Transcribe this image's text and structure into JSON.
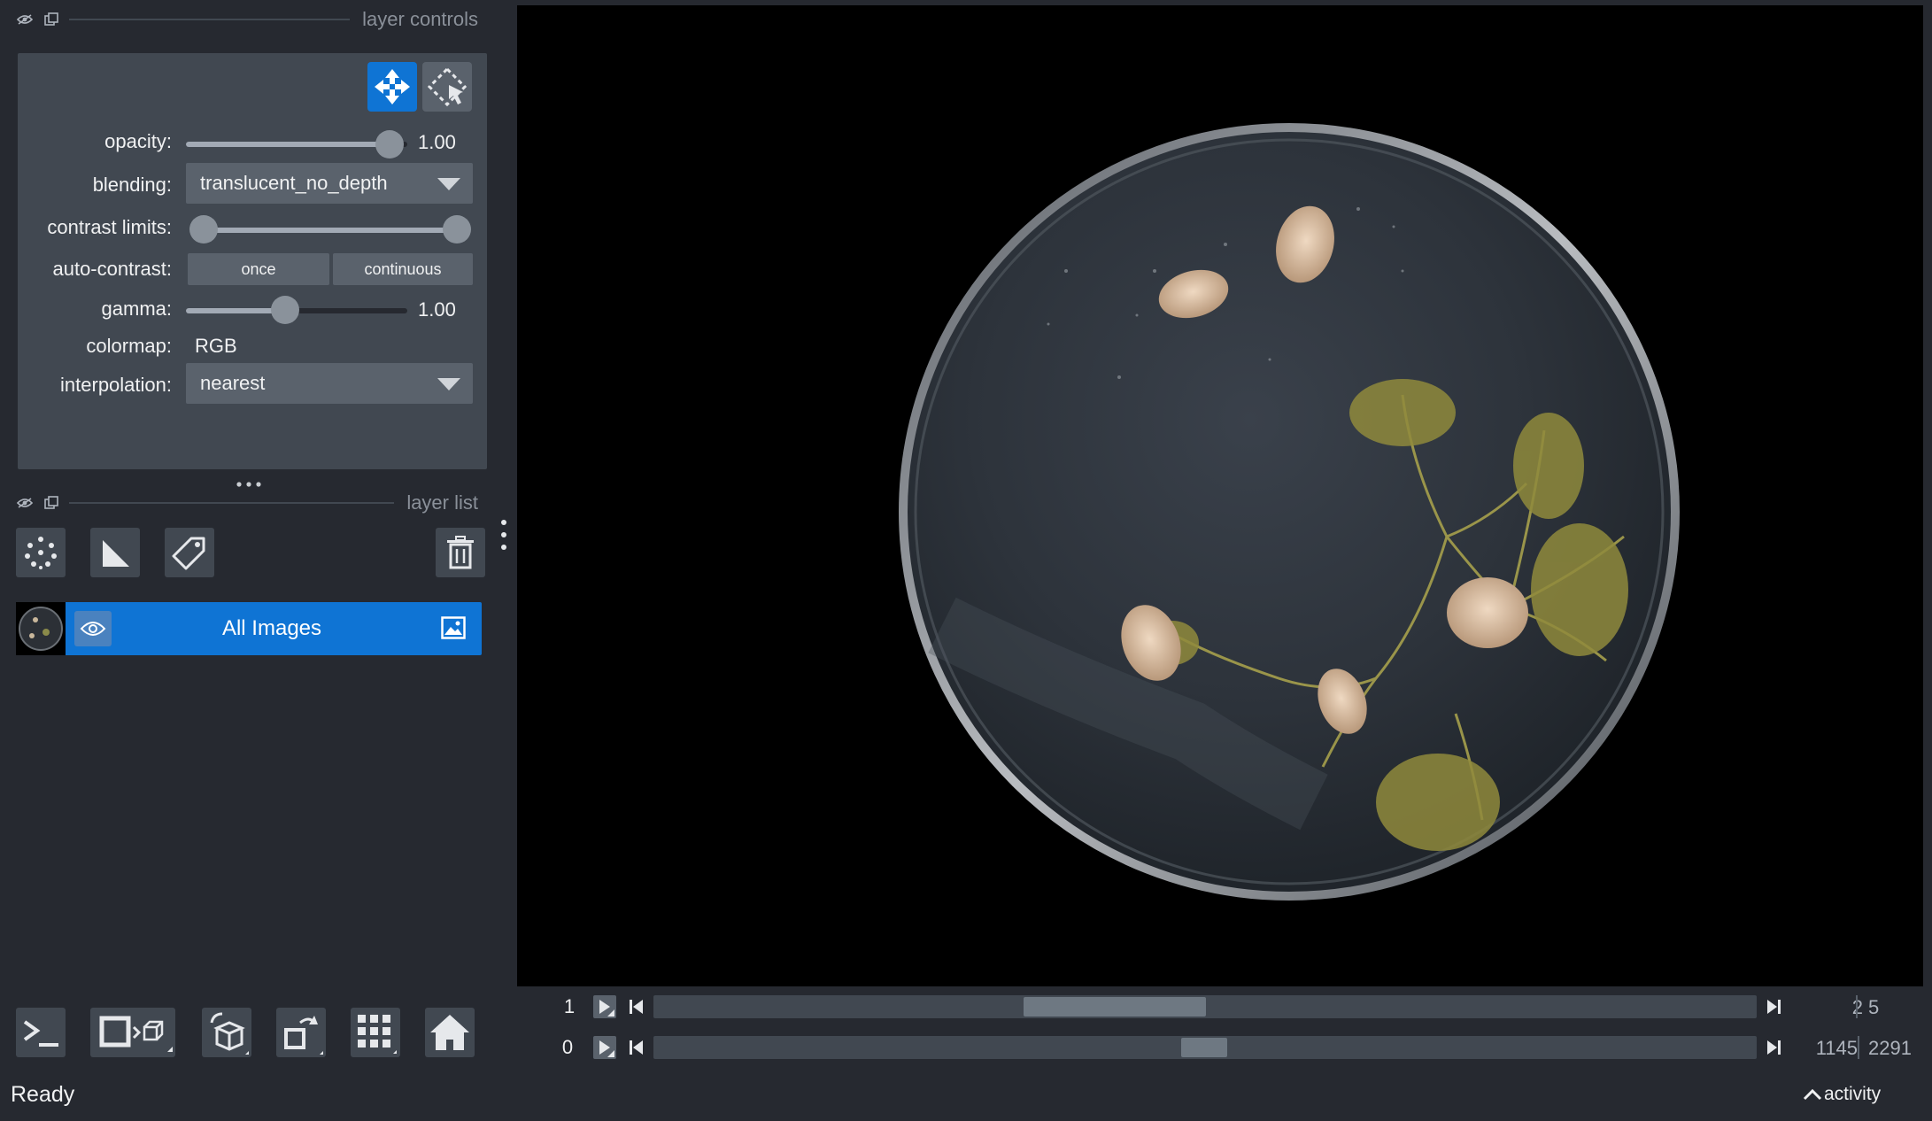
{
  "controls_header": {
    "title": "layer controls"
  },
  "layer_controls": {
    "opacity": {
      "label": "opacity:",
      "value": "1.00",
      "fraction": 1.0
    },
    "blending": {
      "label": "blending:",
      "value": "translucent_no_depth"
    },
    "contrast_limits": {
      "label": "contrast limits:",
      "low_fraction": 0.0,
      "high_fraction": 1.0
    },
    "auto_contrast": {
      "label": "auto-contrast:",
      "once": "once",
      "continuous": "continuous"
    },
    "gamma": {
      "label": "gamma:",
      "value": "1.00",
      "fraction": 0.45
    },
    "colormap": {
      "label": "colormap:",
      "value": "RGB"
    },
    "interpolation": {
      "label": "interpolation:",
      "value": "nearest"
    }
  },
  "list_header": {
    "title": "layer list"
  },
  "layers": [
    {
      "name": "All Images",
      "visible": true,
      "type_icon": "image-icon"
    }
  ],
  "dims": [
    {
      "axis_label": "1",
      "current": "2",
      "max": "5",
      "thumb_start_fraction": 0.335,
      "thumb_fraction": 0.165
    },
    {
      "axis_label": "0",
      "current": "1145",
      "max": "2291",
      "thumb_start_fraction": 0.478,
      "thumb_fraction": 0.043
    }
  ],
  "status": {
    "text": "Ready",
    "activity": "activity"
  },
  "colors": {
    "background": "#262930",
    "panel": "#414851",
    "accent": "#0f74d4",
    "canvas": "#000000"
  }
}
